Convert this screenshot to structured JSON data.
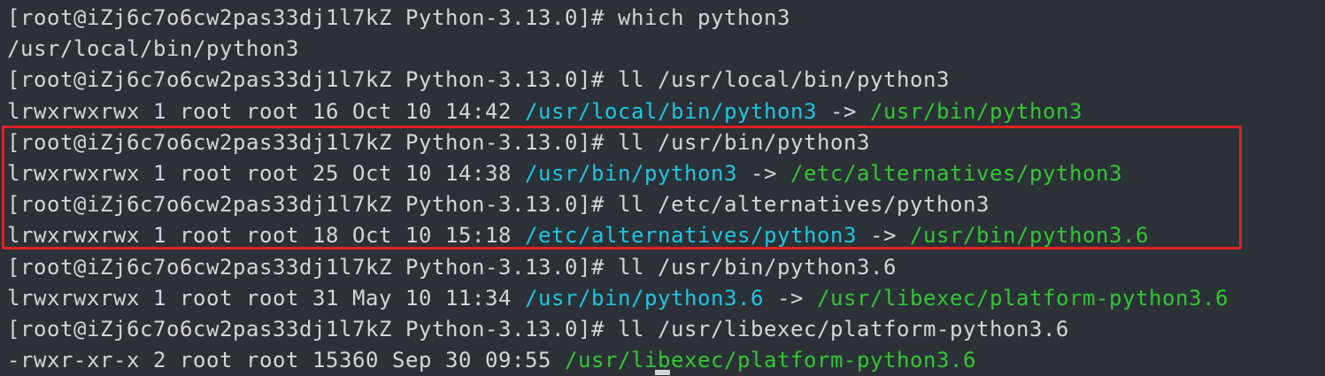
{
  "colors": {
    "background": "#2b3136",
    "text": "#d6d6d6",
    "symlink": "#1ec6e6",
    "target": "#32c832",
    "highlight": "#e02020"
  },
  "terminal": {
    "lines": [
      [
        {
          "text": "[root@iZj6c7o6cw2pas33dj1l7kZ Python-3.13.0]# which python3",
          "style": "plain"
        }
      ],
      [
        {
          "text": "/usr/local/bin/python3",
          "style": "plain"
        }
      ],
      [
        {
          "text": "[root@iZj6c7o6cw2pas33dj1l7kZ Python-3.13.0]# ll /usr/local/bin/python3",
          "style": "plain"
        }
      ],
      [
        {
          "text": "lrwxrwxrwx 1 root root 16 Oct 10 14:42 ",
          "style": "plain"
        },
        {
          "text": "/usr/local/bin/python3",
          "style": "link"
        },
        {
          "text": " -> ",
          "style": "plain"
        },
        {
          "text": "/usr/bin/python3",
          "style": "target"
        }
      ],
      [
        {
          "text": "[root@iZj6c7o6cw2pas33dj1l7kZ Python-3.13.0]# ll /usr/bin/python3",
          "style": "plain"
        }
      ],
      [
        {
          "text": "lrwxrwxrwx 1 root root 25 Oct 10 14:38 ",
          "style": "plain"
        },
        {
          "text": "/usr/bin/python3",
          "style": "link"
        },
        {
          "text": " -> ",
          "style": "plain"
        },
        {
          "text": "/etc/alternatives/python3",
          "style": "target"
        }
      ],
      [
        {
          "text": "[root@iZj6c7o6cw2pas33dj1l7kZ Python-3.13.0]# ll /etc/alternatives/python3",
          "style": "plain"
        }
      ],
      [
        {
          "text": "lrwxrwxrwx 1 root root 18 Oct 10 15:18 ",
          "style": "plain"
        },
        {
          "text": "/etc/alternatives/python3",
          "style": "link"
        },
        {
          "text": " -> ",
          "style": "plain"
        },
        {
          "text": "/usr/bin/python3.6",
          "style": "target"
        }
      ],
      [
        {
          "text": "[root@iZj6c7o6cw2pas33dj1l7kZ Python-3.13.0]# ll /usr/bin/python3.6",
          "style": "plain"
        }
      ],
      [
        {
          "text": "lrwxrwxrwx 1 root root 31 May 10 11:34 ",
          "style": "plain"
        },
        {
          "text": "/usr/bin/python3.6",
          "style": "link"
        },
        {
          "text": " -> ",
          "style": "plain"
        },
        {
          "text": "/usr/libexec/platform-python3.6",
          "style": "target"
        }
      ],
      [
        {
          "text": "[root@iZj6c7o6cw2pas33dj1l7kZ Python-3.13.0]# ll /usr/libexec/platform-python3.6",
          "style": "plain"
        }
      ],
      [
        {
          "text": "-rwxr-xr-x 2 root root 15360 Sep 30 09:55 ",
          "style": "plain"
        },
        {
          "text": "/usr/libexec/platform-python3.6",
          "style": "target"
        }
      ]
    ]
  }
}
